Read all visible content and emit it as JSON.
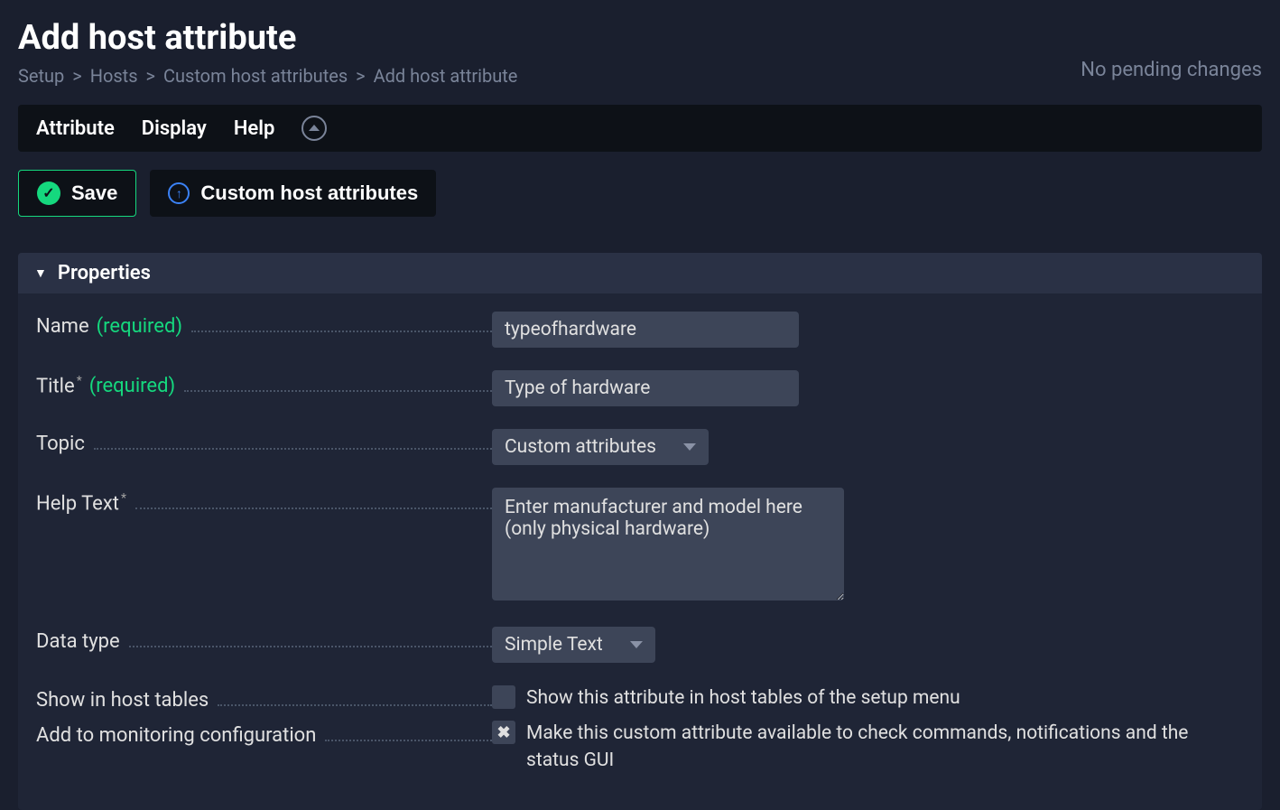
{
  "header": {
    "title": "Add host attribute",
    "breadcrumb": {
      "setup": "Setup",
      "hosts": "Hosts",
      "custom_attrs": "Custom host attributes",
      "current": "Add host attribute"
    },
    "pending": "No pending changes"
  },
  "menu": {
    "attribute": "Attribute",
    "display": "Display",
    "help": "Help"
  },
  "actions": {
    "save": "Save",
    "custom_attrs": "Custom host attributes"
  },
  "section": {
    "title": "Properties"
  },
  "fields": {
    "name": {
      "label": "Name",
      "required": "(required)",
      "value": "typeofhardware"
    },
    "title": {
      "label": "Title",
      "required": "(required)",
      "value": "Type of hardware"
    },
    "topic": {
      "label": "Topic",
      "value": "Custom attributes"
    },
    "helptext": {
      "label": "Help Text",
      "value": "Enter manufacturer and model here (only physical hardware)"
    },
    "datatype": {
      "label": "Data type",
      "value": "Simple Text"
    },
    "show_in_tables": {
      "label": "Show in host tables",
      "checkbox_label": "Show this attribute in host tables of the setup menu",
      "checked": false
    },
    "add_to_monitoring": {
      "label": "Add to monitoring configuration",
      "checkbox_label": "Make this custom attribute available to check commands, notifications and the status GUI",
      "checked": true
    }
  }
}
